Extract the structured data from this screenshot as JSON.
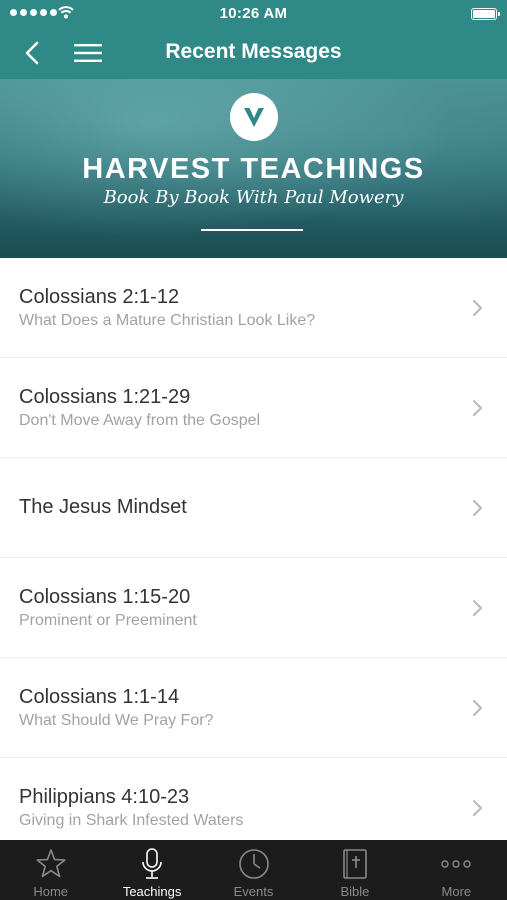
{
  "status_bar": {
    "time": "10:26 AM"
  },
  "nav": {
    "title": "Recent Messages"
  },
  "banner": {
    "title": "HARVEST TEACHINGS",
    "subtitle": "Book By Book With Paul Mowery"
  },
  "messages": [
    {
      "title": "Colossians 2:1-12",
      "subtitle": "What Does a Mature Christian Look Like?"
    },
    {
      "title": "Colossians 1:21-29",
      "subtitle": "Don't Move Away from the Gospel"
    },
    {
      "title": "The Jesus Mindset",
      "subtitle": ""
    },
    {
      "title": "Colossians 1:15-20",
      "subtitle": "Prominent or Preeminent"
    },
    {
      "title": "Colossians 1:1-14",
      "subtitle": "What Should We Pray For?"
    },
    {
      "title": "Philippians 4:10-23",
      "subtitle": "Giving in Shark Infested Waters"
    }
  ],
  "tabs": [
    {
      "label": "Home",
      "icon": "star-icon",
      "active": false
    },
    {
      "label": "Teachings",
      "icon": "microphone-icon",
      "active": true
    },
    {
      "label": "Events",
      "icon": "clock-icon",
      "active": false
    },
    {
      "label": "Bible",
      "icon": "bible-icon",
      "active": false
    },
    {
      "label": "More",
      "icon": "more-dots-icon",
      "active": false
    }
  ],
  "colors": {
    "brand": "#2f8a87",
    "tab_bar": "#1c1c1c",
    "active_tab": "#ffffff",
    "inactive_tab": "#8a8a8a"
  }
}
